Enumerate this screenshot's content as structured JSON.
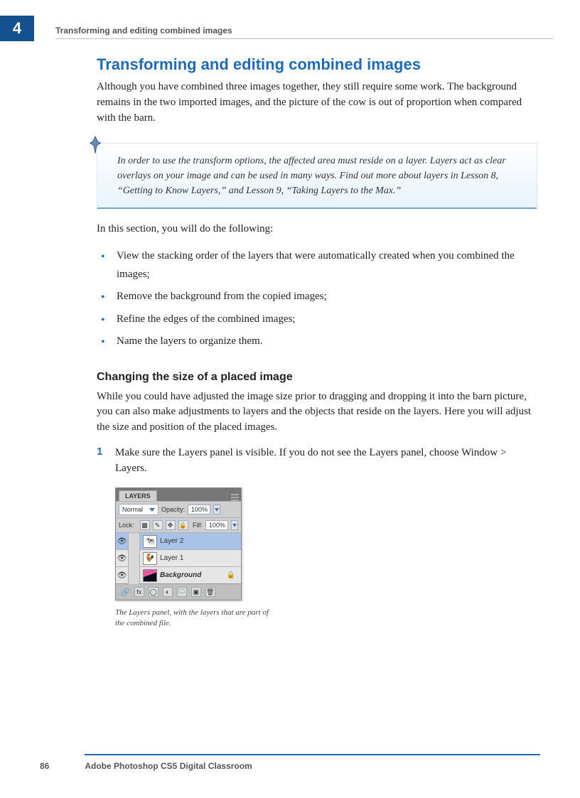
{
  "chapter_number": "4",
  "running_head": "Transforming and editing combined images",
  "section": {
    "title": "Transforming and editing combined images",
    "intro": "Although you have combined three images together, they still require some work. The background remains in the two imported images, and the picture of the cow is out of proportion when compared with the barn."
  },
  "note": "In order to use the transform options, the affected area must reside on a layer. Layers act as clear overlays on your image and can be used in many ways. Find out more about layers in Lesson 8, “Getting to Know Layers,” and Lesson 9, “Taking Layers to the Max.”",
  "list_intro": "In this section, you will do the following:",
  "bullets": [
    "View the stacking order of the layers that were automatically created when you combined the images;",
    "Remove the background from the copied images;",
    "Refine the edges of the combined images;",
    "Name the layers to organize them."
  ],
  "subsection": {
    "title": "Changing the size of a placed image",
    "body": "While you could have adjusted the image size prior to dragging and dropping it into the barn picture, you can also make adjustments to layers and the objects that reside on the layers. Here you will adjust the size and position of the placed images.",
    "step_number": "1",
    "step_text": "Make sure the Layers panel is visible. If you do not see the Layers panel, choose Window > Layers."
  },
  "layers_panel": {
    "tab": "LAYERS",
    "blend_mode": "Normal",
    "opacity_label": "Opacity:",
    "opacity_value": "100%",
    "lock_label": "Lock:",
    "fill_label": "Fill:",
    "fill_value": "100%",
    "layers": [
      {
        "name": "Layer 2",
        "selected": true,
        "thumb": "🐄"
      },
      {
        "name": "Layer 1",
        "selected": false,
        "thumb": "🐓"
      },
      {
        "name": "Background",
        "selected": false,
        "bg": true,
        "locked": true
      }
    ]
  },
  "caption": "The Layers panel, with the layers that are part of the combined file.",
  "page_number": "86",
  "book_title": "Adobe Photoshop CS5 Digital Classroom"
}
